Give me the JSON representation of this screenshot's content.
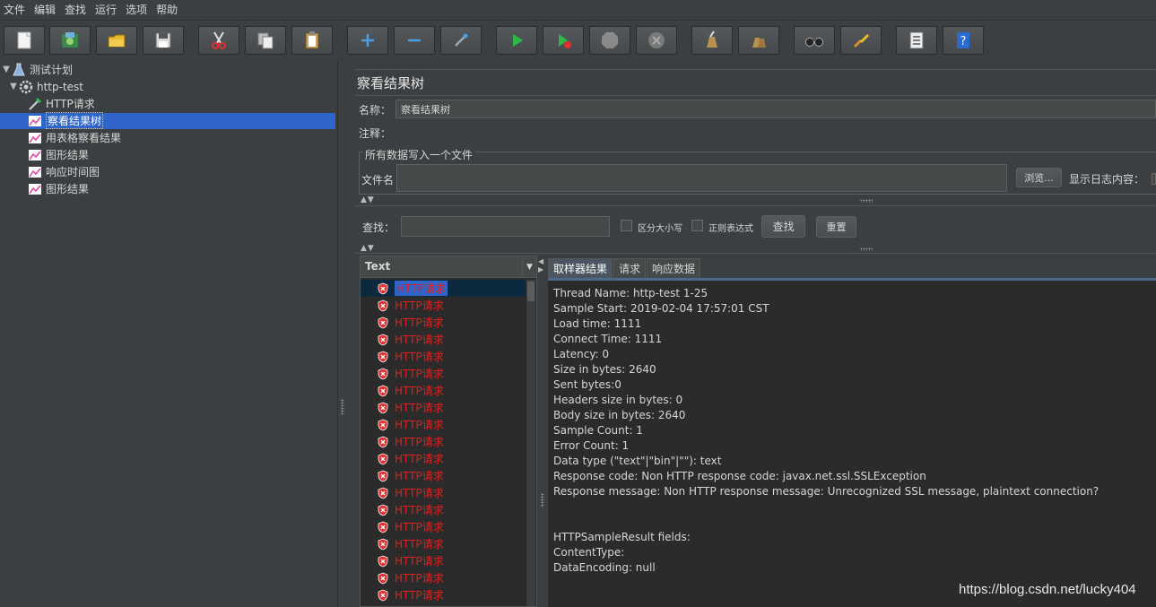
{
  "menu": [
    "文件",
    "编辑",
    "查找",
    "运行",
    "选项",
    "帮助"
  ],
  "toolbar": {
    "buttons": [
      "new-icon",
      "templates-icon",
      "open-icon",
      "save-icon",
      "cut-icon",
      "copy-icon",
      "paste-icon",
      "expand-icon",
      "collapse-icon",
      "toggle-icon",
      "start-icon",
      "start-no-pause-icon",
      "stop-icon",
      "shutdown-icon",
      "clear-icon",
      "clear-all-icon",
      "search-icon",
      "reset-search-icon",
      "function-helper-icon",
      "help-icon"
    ]
  },
  "tree": {
    "test_plan": "测试计划",
    "thread_group": "http-test",
    "items": [
      {
        "label": "HTTP请求",
        "icon": "sampler-icon"
      },
      {
        "label": "察看结果树",
        "icon": "listener-icon"
      },
      {
        "label": "用表格察看结果",
        "icon": "listener-icon"
      },
      {
        "label": "图形结果",
        "icon": "listener-icon"
      },
      {
        "label": "响应时间图",
        "icon": "listener-icon"
      },
      {
        "label": "图形结果",
        "icon": "listener-icon"
      }
    ]
  },
  "panel": {
    "title": "察看结果树",
    "name_label": "名称：",
    "name_value": "察看结果树",
    "comment_label": "注释：",
    "comment_value": "",
    "file_section_legend": "所有数据写入一个文件",
    "filename_label": "文件名",
    "filename_value": "",
    "browse_label": "浏览...",
    "log_display_label": "显示日志内容：",
    "search_label": "查找：",
    "search_value": "",
    "case_sensitive_label": "区分大小写",
    "regex_label": "正则表达式",
    "find_button": "查找",
    "reset_button": "重置"
  },
  "results": {
    "renderer": "Text",
    "row_label": "HTTP请求",
    "row_count": 19
  },
  "tabs": [
    "取样器结果",
    "请求",
    "响应数据"
  ],
  "sampler_result": [
    "Thread Name: http-test 1-25",
    "Sample Start: 2019-02-04 17:57:01 CST",
    "Load time: 1111",
    "Connect Time: 1111",
    "Latency: 0",
    "Size in bytes: 2640",
    "Sent bytes:0",
    "Headers size in bytes: 0",
    "Body size in bytes: 2640",
    "Sample Count: 1",
    "Error Count: 1",
    "Data type (\"text\"|\"bin\"|\"\"): text",
    "Response code: Non HTTP response code: javax.net.ssl.SSLException",
    "Response message: Non HTTP response message: Unrecognized SSL message, plaintext connection?",
    "",
    "",
    "HTTPSampleResult fields:",
    "ContentType: ",
    "DataEncoding: null"
  ],
  "watermark": "https://blog.csdn.net/lucky404",
  "colors": {
    "background": "#3c3f41",
    "selection": "#2f65ca",
    "error_text": "#e02020"
  }
}
